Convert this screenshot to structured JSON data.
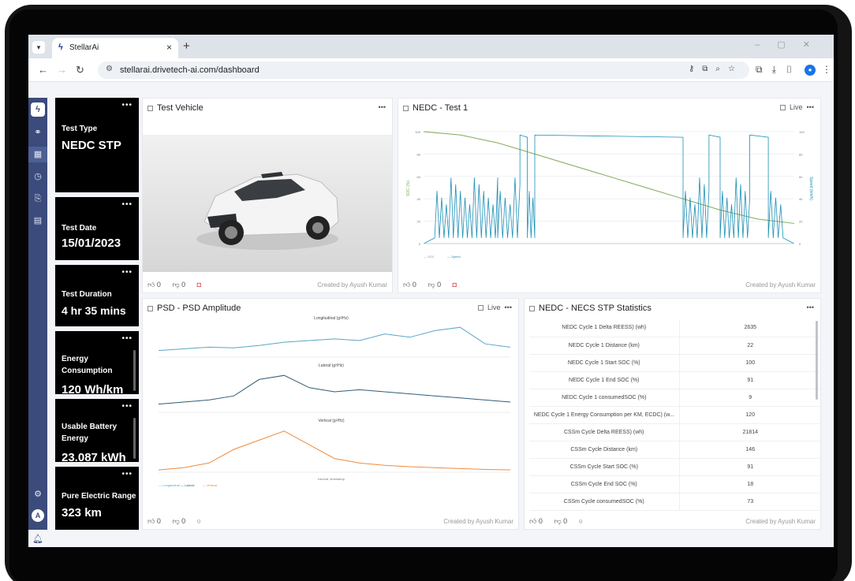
{
  "browser": {
    "tab_title": "StellarAi",
    "url": "stellarai.drivetech-ai.com/dashboard"
  },
  "sidebar": {
    "avatar_initial": "A"
  },
  "kpis": [
    {
      "label": "Test Type",
      "value": "NEDC STP"
    },
    {
      "label": "Test Date",
      "value": "15/01/2023"
    },
    {
      "label": "Test Duration",
      "value": "4 hr 35 mins"
    },
    {
      "label": "Energy Consumption",
      "value": "120 Wh/km"
    },
    {
      "label": "Usable Battery Energy",
      "value": "23.087 kWh"
    },
    {
      "label": "Pure Electric Range",
      "value": "323 km"
    }
  ],
  "panels": {
    "vehicle": {
      "title": "Test Vehicle",
      "likes": "0",
      "dislikes": "0",
      "created_by": "Created by Ayush Kumar"
    },
    "nedc": {
      "title": "NEDC - Test 1",
      "live": "Live",
      "likes": "0",
      "dislikes": "0",
      "created_by": "Created by Ayush Kumar"
    },
    "psd": {
      "title": "PSD - PSD Amplitude",
      "live": "Live",
      "likes": "0",
      "dislikes": "0",
      "created_by": "Created by Ayush Kumar"
    },
    "stats": {
      "title": "NEDC - NECS STP Statistics",
      "likes": "0",
      "dislikes": "0",
      "created_by": "Created by Ayush Kumar"
    }
  },
  "stats_rows": [
    {
      "name": "NEDC Cycle 1 Delta REESS) (wh)",
      "value": "2635"
    },
    {
      "name": "NEDC Cycle 1 Distance (km)",
      "value": "22"
    },
    {
      "name": "NEDC Cycle 1 Start SOC (%)",
      "value": "100"
    },
    {
      "name": "NEDC Cycle 1 End SOC (%)",
      "value": "91"
    },
    {
      "name": "NEDC Cycle 1 consumedSOC (%)",
      "value": "9"
    },
    {
      "name": "NEDC Cycle 1 Energy Consumption per KM, ECDC) (w...",
      "value": "120"
    },
    {
      "name": "CSSm Cycle Delta REESS) (wh)",
      "value": "21814"
    },
    {
      "name": "CSSm Cycle Distance (km)",
      "value": "146"
    },
    {
      "name": "CSSm Cycle Start SOC (%)",
      "value": "91"
    },
    {
      "name": "CSSm Cycle End SOC (%)",
      "value": "18"
    },
    {
      "name": "CSSm Cycle consumedSOC (%)",
      "value": "73"
    }
  ],
  "chart_data": [
    {
      "type": "line",
      "title": "NEDC - Test 1",
      "ylabel": "SOC (%)",
      "y2label": "Speed (km/h)",
      "ylim": [
        0,
        100
      ],
      "series": [
        {
          "name": "SOC",
          "x": [
            0,
            10,
            20,
            30,
            40,
            50,
            60,
            70,
            80,
            90,
            100
          ],
          "values": [
            100,
            97,
            90,
            80,
            70,
            60,
            50,
            40,
            30,
            22,
            18
          ]
        },
        {
          "name": "Speed",
          "values": [
            0,
            20,
            60,
            30,
            60,
            110,
            110,
            110,
            110,
            50,
            110,
            110
          ]
        }
      ]
    },
    {
      "type": "line",
      "title": "Longitudinal (g²/Hz)",
      "series": [
        {
          "name": "Longitudinal",
          "values": [
            0.2,
            0.25,
            0.3,
            0.28,
            0.35,
            0.45,
            0.5,
            0.55,
            0.5,
            0.7,
            0.6,
            0.8,
            0.9,
            0.4,
            0.3
          ]
        }
      ]
    },
    {
      "type": "line",
      "title": "Lateral (g²/Hz)",
      "series": [
        {
          "name": "Lateral",
          "values": [
            0.2,
            0.25,
            0.3,
            0.4,
            0.8,
            0.9,
            0.6,
            0.5,
            0.55,
            0.5,
            0.45,
            0.4,
            0.35,
            0.3,
            0.25
          ]
        }
      ]
    },
    {
      "type": "line",
      "title": "Vertical (g²/Hz)",
      "xlabel": "Interval, timestamp",
      "series": [
        {
          "name": "Vertical",
          "values": [
            0.05,
            0.1,
            0.2,
            0.5,
            0.7,
            0.9,
            0.6,
            0.3,
            0.2,
            0.15,
            0.12,
            0.1,
            0.08,
            0.06,
            0.05
          ]
        }
      ]
    }
  ],
  "colors": {
    "sidebar": "#3b4b7c",
    "card": "#000000",
    "soc_line": "#7faa5a",
    "speed_line": "#1c8fb6",
    "long_line": "#5aa6c4",
    "lat_line": "#2f5d78",
    "vert_line": "#f08a3c"
  }
}
